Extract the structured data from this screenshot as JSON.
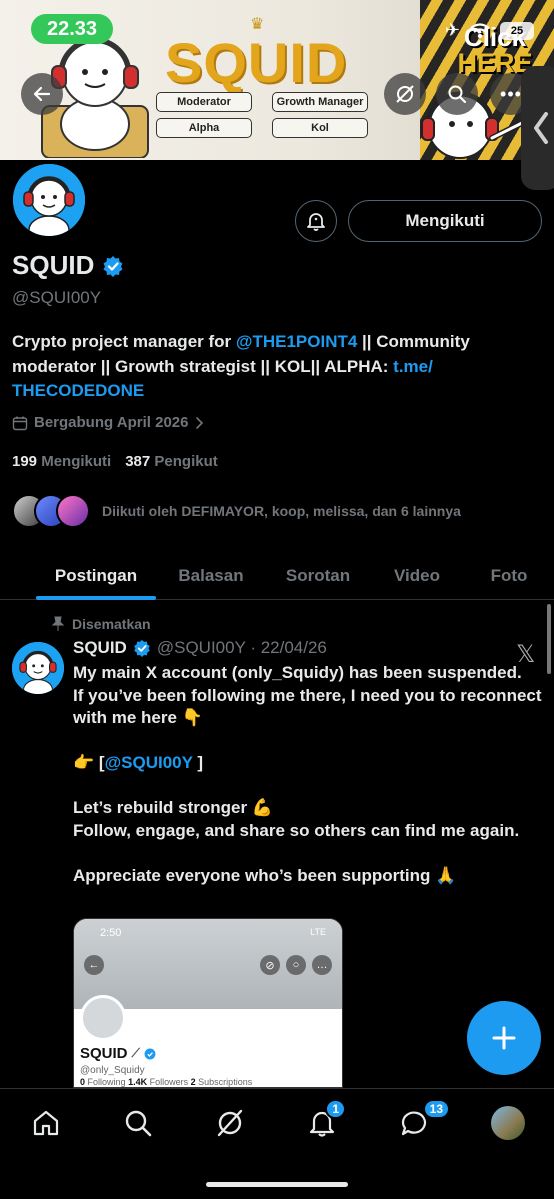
{
  "status_bar": {
    "time": "22.33",
    "battery": "25"
  },
  "banner": {
    "title": "SQUID",
    "chips": [
      "Moderator",
      "Growth Manager",
      "Alpha",
      "Kol"
    ],
    "cta_line1": "Click",
    "cta_line2": "HERE"
  },
  "profile": {
    "name": "SQUID",
    "handle": "@SQUI00Y",
    "follow_label": "Mengikuti",
    "bio_part1": "Crypto project manager for ",
    "bio_mention": "@THE1POINT4",
    "bio_part2": " || Community moderator || Growth strategist || KOL|| ALPHA: ",
    "bio_link": "t.me/ THECODEDONE",
    "joined": "Bergabung April 2026",
    "following_count": "199",
    "following_label": "Mengikuti",
    "followers_count": "387",
    "followers_label": "Pengikut",
    "followed_by": "Diikuti oleh DEFIMAYOR, koop, melissa, dan 6 lainnya"
  },
  "tabs": [
    "Postingan",
    "Balasan",
    "Sorotan",
    "Video",
    "Foto"
  ],
  "post": {
    "pinned_label": "Disematkan",
    "author": "SQUID",
    "meta": "@SQUI00Y · 22/04/26",
    "line1": "My main X account (only_Squidy) has been suspended.",
    "line2": "If you’ve been following me there, I need you to reconnect with me here 👇",
    "line3_prefix": "👉 [",
    "line3_mention": "@SQUI00Y",
    "line3_suffix": " ]",
    "line4": "Let’s rebuild stronger 💪",
    "line5": "Follow, engage, and share so others can find me again.",
    "line6": "Appreciate everyone who’s been supporting 🙏"
  },
  "embed": {
    "time": "2:50",
    "network": "LTE",
    "name": "SQUID",
    "handle": "@only_Squidy",
    "following_count": "0",
    "following_label": "Following",
    "followers_count": "1.4K",
    "followers_label": "Followers",
    "subs_count": "2",
    "subs_label": "Subscriptions"
  },
  "nav": {
    "notifications_badge": "1",
    "messages_badge": "13"
  },
  "colors": {
    "accent": "#1d9bf0",
    "time_badge": "#34c759",
    "banner_gold": "#e2a51c"
  }
}
